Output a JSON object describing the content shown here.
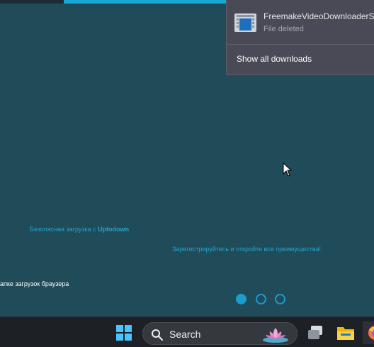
{
  "colors": {
    "background": "#204b58",
    "accent": "#17a8d6",
    "panel": "#4a4a56",
    "taskbar": "#1d2024"
  },
  "downloads_panel": {
    "item": {
      "file_name": "FreemakeVideoDownloaderSe",
      "status": "File deleted",
      "icon": "video-file-icon"
    },
    "show_all_label": "Show all downloads"
  },
  "page": {
    "promo_line_1": "Безопасная загрузка с ",
    "promo_brand": "Uptodown",
    "promo_line_2": "Зарегистрируйтесь и откройте все преимущества!",
    "side_text": "апке загрузок браузера",
    "carousel": {
      "total": 3,
      "active": 1
    }
  },
  "taskbar": {
    "search_label": "Search",
    "icons": [
      "windows-start-icon",
      "search-icon",
      "lotus-highlight-icon",
      "task-view-icon",
      "file-explorer-icon",
      "firefox-icon"
    ]
  }
}
